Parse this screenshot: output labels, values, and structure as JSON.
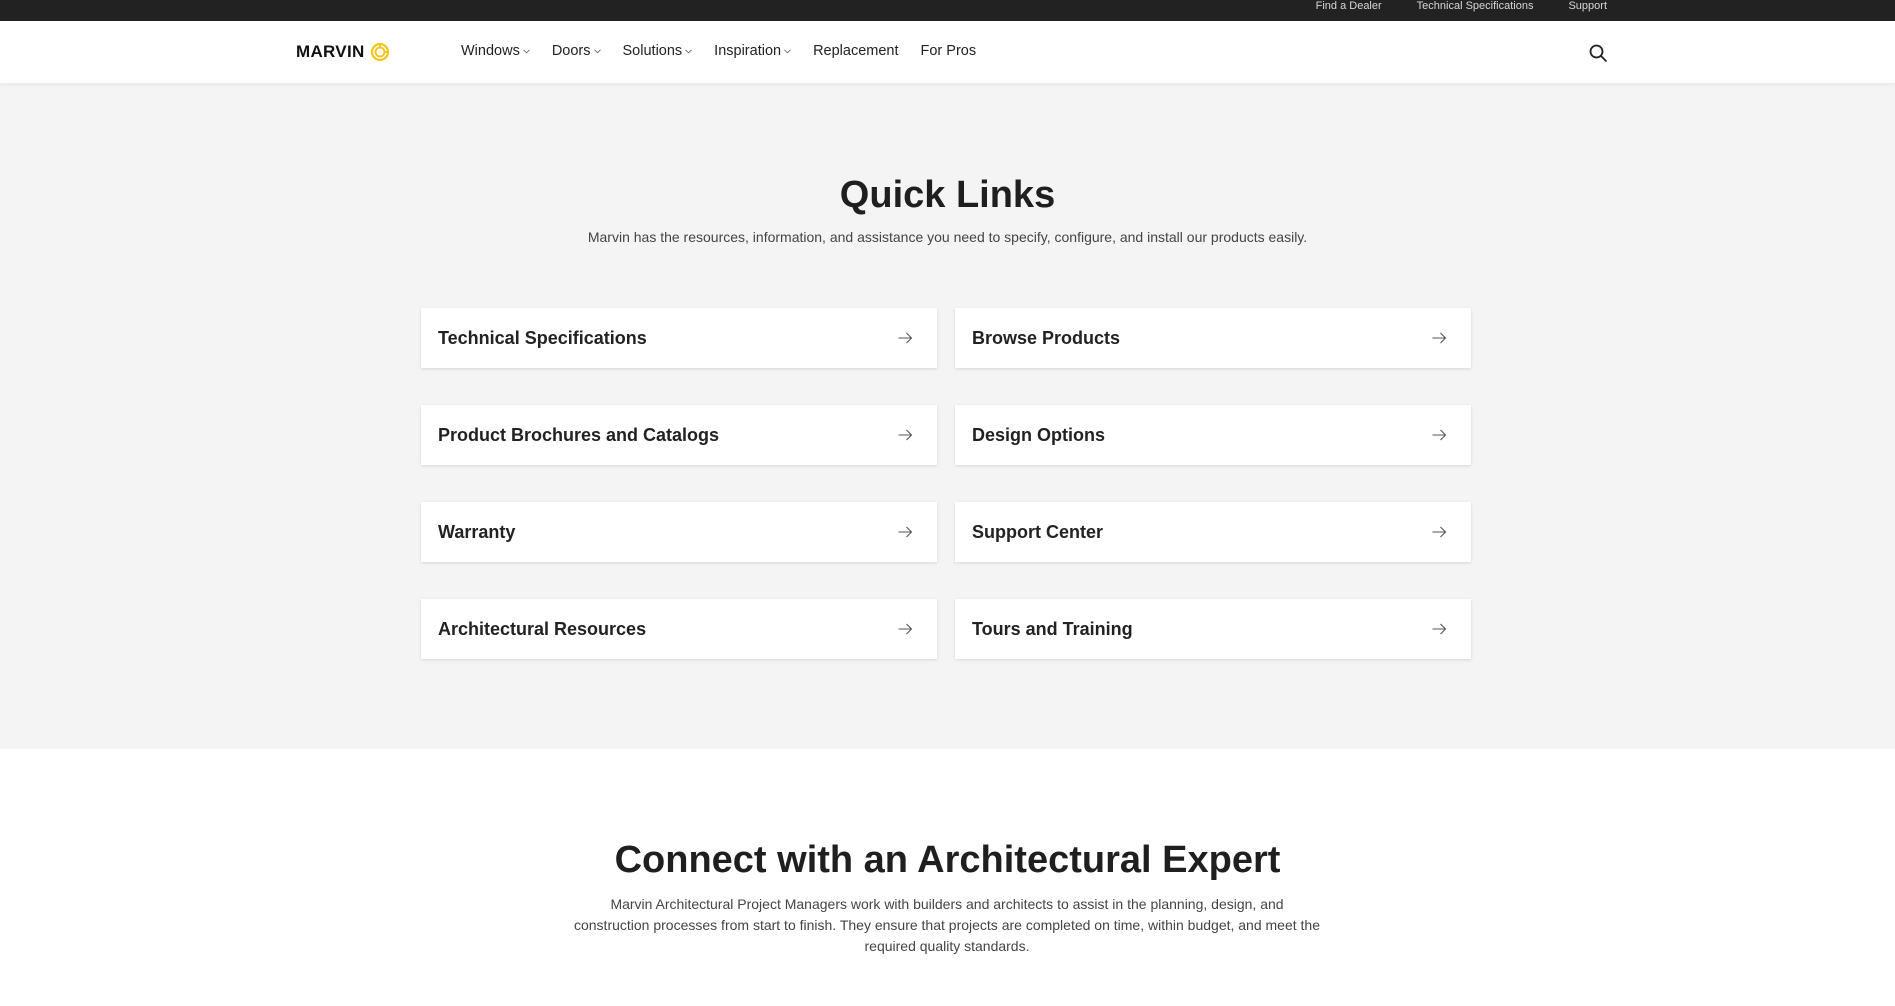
{
  "utility_nav": [
    "Find a Dealer",
    "Technical Specifications",
    "Support"
  ],
  "brand": {
    "name": "MARVIN",
    "accent_color": "#f5c518"
  },
  "main_nav": {
    "items": [
      {
        "label": "Windows",
        "has_dropdown": true
      },
      {
        "label": "Doors",
        "has_dropdown": true
      },
      {
        "label": "Solutions",
        "has_dropdown": true
      },
      {
        "label": "Inspiration",
        "has_dropdown": true
      },
      {
        "label": "Replacement",
        "has_dropdown": false
      },
      {
        "label": "For Pros",
        "has_dropdown": false
      }
    ],
    "search_icon": "search-icon"
  },
  "quick_links": {
    "title": "Quick Links",
    "subtitle": "Marvin has the resources, information, and assistance you need to specify, configure, and install our products easily.",
    "cards": [
      "Technical Specifications",
      "Browse Products",
      "Product Brochures and Catalogs",
      "Design Options",
      "Warranty",
      "Support Center",
      "Architectural Resources",
      "Tours and Training"
    ],
    "card_icon": "arrow-right-icon"
  },
  "connect": {
    "title": "Connect with an Architectural Expert",
    "body": "Marvin Architectural Project Managers work with builders and architects to assist in the planning, design, and construction processes from start to finish. They ensure that projects are completed on time, within budget, and meet the required quality standards."
  },
  "colors": {
    "utility_bar_bg": "#222222",
    "section_bg": "#f4f4f4",
    "card_bg": "#ffffff",
    "text_primary": "#222222"
  }
}
